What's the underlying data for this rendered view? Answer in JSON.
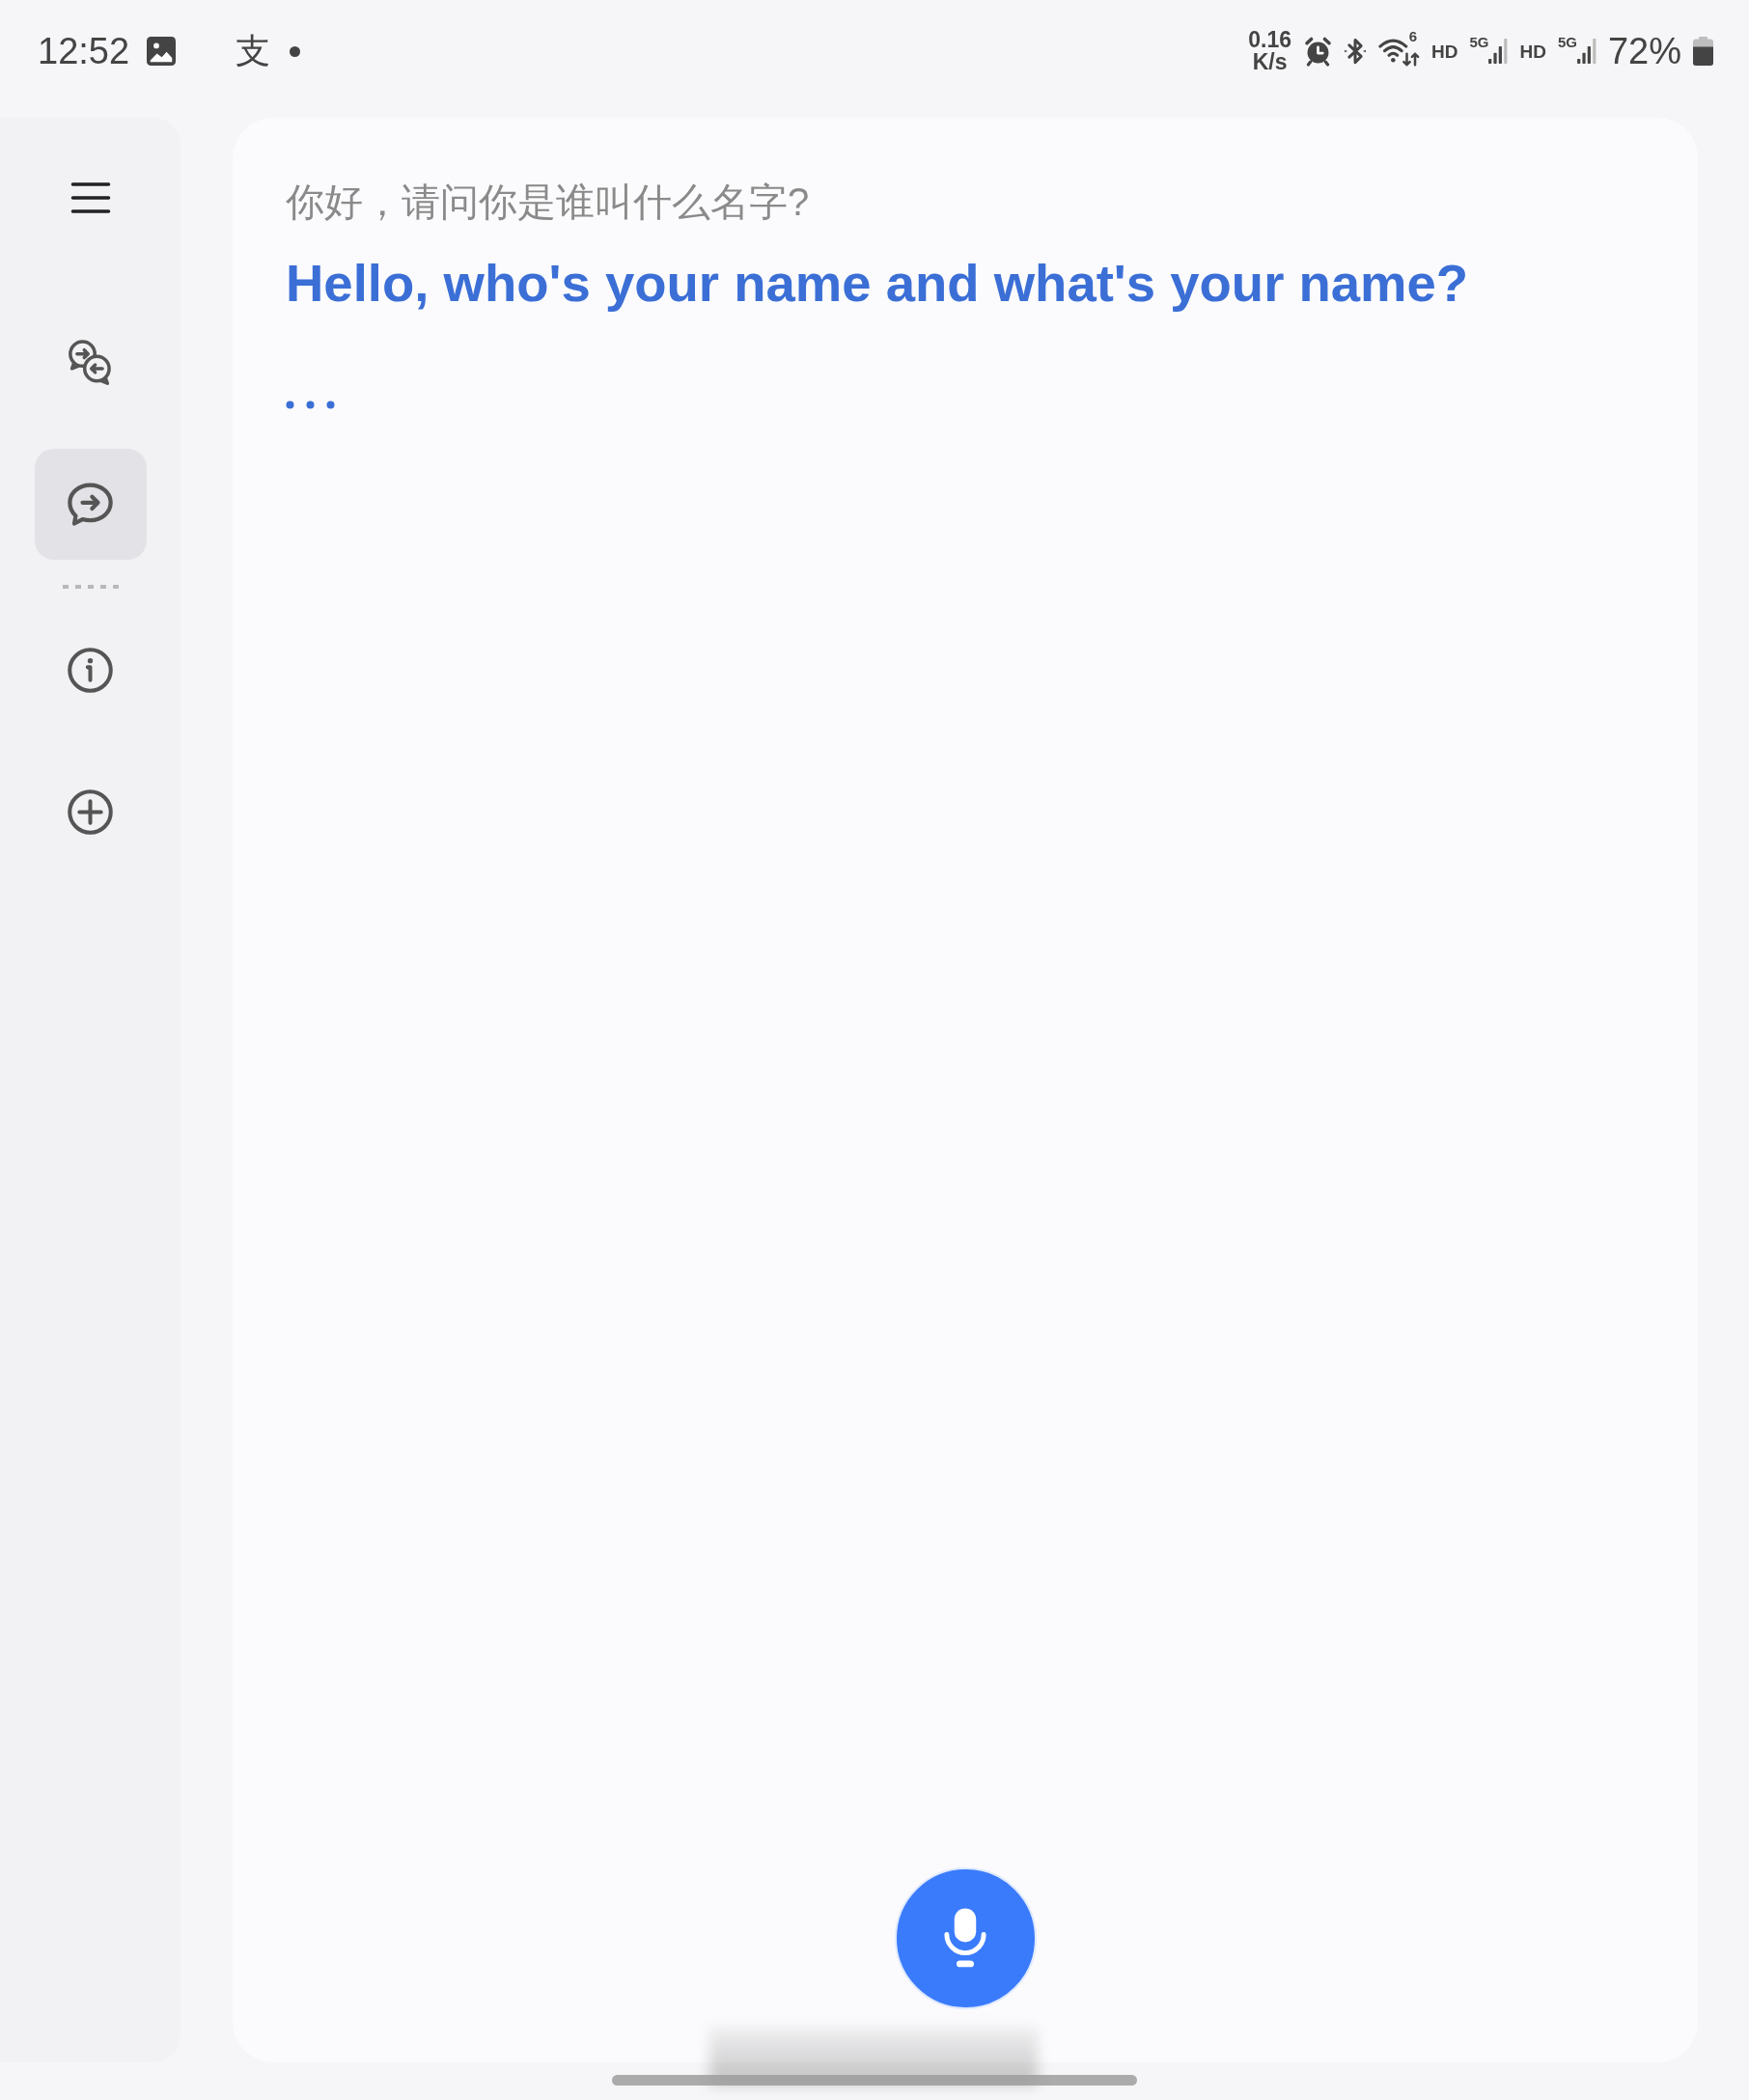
{
  "status_bar": {
    "time": "12:52",
    "notification_glyph": "支",
    "network_speed": {
      "value": "0.16",
      "unit": "K/s"
    },
    "wifi_standard": "6",
    "sim_slots": [
      {
        "voice": "HD",
        "network": "5G"
      },
      {
        "voice": "HD",
        "network": "5G"
      }
    ],
    "battery_percent": "72%"
  },
  "sidebar": {
    "groups": [
      [
        {
          "kind": "conversation",
          "selected": false
        },
        {
          "kind": "chat",
          "selected": true
        }
      ],
      [
        {
          "kind": "info",
          "selected": false
        },
        {
          "kind": "add",
          "selected": false
        }
      ]
    ]
  },
  "conversation": {
    "source_text": "你好，请问你是谁叫什么名字?",
    "translation": "Hello, who's your name and what's your name?",
    "pending": true
  }
}
